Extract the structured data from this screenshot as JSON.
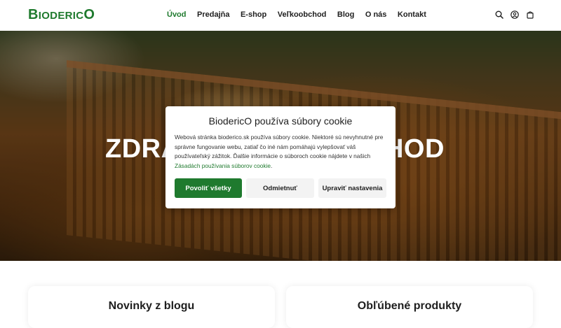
{
  "header": {
    "logo": {
      "first_big": "B",
      "first_small": "IODERIC",
      "last_big": "O"
    },
    "nav": [
      {
        "label": "Úvod",
        "active": true
      },
      {
        "label": "Predajňa",
        "active": false
      },
      {
        "label": "E-shop",
        "active": false
      },
      {
        "label": "Veľkoobchod",
        "active": false
      },
      {
        "label": "Blog",
        "active": false
      },
      {
        "label": "O nás",
        "active": false
      },
      {
        "label": "Kontakt",
        "active": false
      }
    ],
    "icons": [
      "search-icon",
      "user-icon",
      "cart-icon"
    ]
  },
  "hero": {
    "title_left": "ZDRA",
    "title_right": "CHOD"
  },
  "cookie_modal": {
    "title": "BiodericO používa súbory cookie",
    "text": "Webová stránka bioderico.sk používa súbory cookie. Niektoré sú nevyhnutné pre správne fungovanie webu, zatiaľ čo iné nám pomáhajú vylepšovať váš používateľský zážitok. Ďalšie informácie o súboroch cookie nájdete v našich",
    "link": "Zásadách používania súborov cookie",
    "link_suffix": ".",
    "buttons": {
      "allow": "Povoliť všetky",
      "deny": "Odmietnuť",
      "settings": "Upraviť nastavenia"
    }
  },
  "sections": {
    "blog_title": "Novinky z blogu",
    "products_title": "Obľúbené produkty"
  },
  "colors": {
    "accent": "#1f7a2e",
    "text": "#1e1e1e"
  }
}
